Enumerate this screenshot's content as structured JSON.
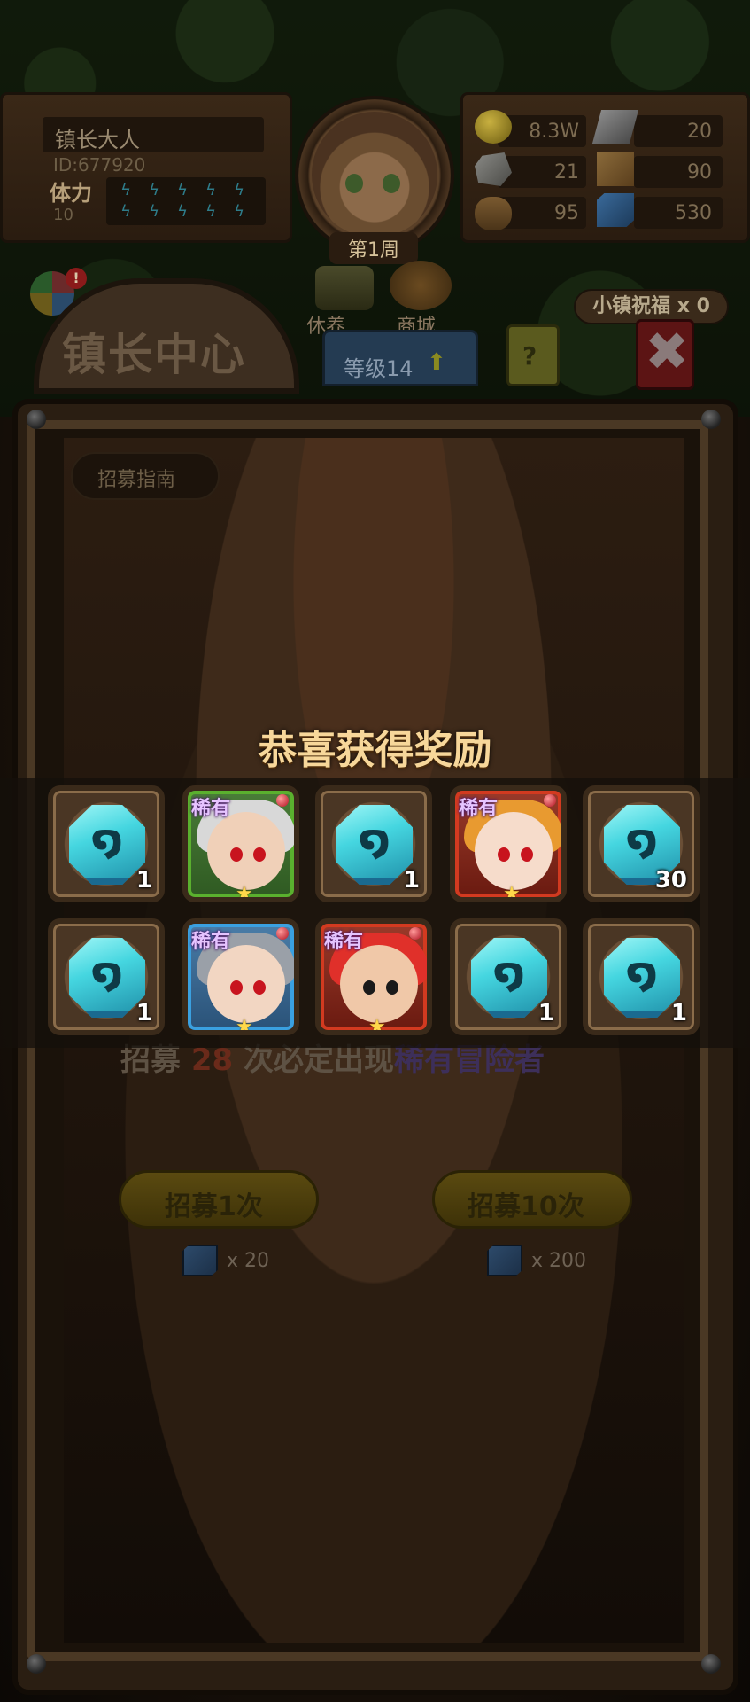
{
  "player": {
    "name": "镇长大人",
    "id": "ID:677920",
    "stamina_label": "体力",
    "stamina_value": "10",
    "week": "第1周"
  },
  "resources": [
    {
      "icon": "gold-coin-icon",
      "value": "8.3W"
    },
    {
      "icon": "iron-ingot-icon",
      "value": "20"
    },
    {
      "icon": "stone-ore-icon",
      "value": "21"
    },
    {
      "icon": "map-scroll-icon",
      "value": "90"
    },
    {
      "icon": "wood-log-icon",
      "value": "95"
    },
    {
      "icon": "blue-gem-icon",
      "value": "530"
    }
  ],
  "nav": {
    "rest": "休养",
    "shop": "商城",
    "blessing": "小镇祝福 x 0",
    "notification_badge": "!"
  },
  "tabs": {
    "center": "镇长中心",
    "level": "等级14",
    "help": "?",
    "close": "✖"
  },
  "recruit": {
    "guide": "招募指南",
    "pity_prefix": "招募",
    "pity_count": "28",
    "pity_mid": "次必定出现",
    "pity_rare": "稀有冒险者",
    "single_label": "招募1次",
    "single_cost": "x 20",
    "ten_label": "招募10次",
    "ten_cost": "x 200"
  },
  "reward": {
    "title": "恭喜获得奖励",
    "rare_tag": "稀有",
    "items": [
      {
        "kind": "item",
        "name": "rune-stone",
        "qty": "1"
      },
      {
        "kind": "hero",
        "name": "white-hair-hero",
        "frame": "green",
        "tag": "稀有"
      },
      {
        "kind": "item",
        "name": "rune-stone",
        "qty": "1"
      },
      {
        "kind": "hero",
        "name": "orange-hair-heroine",
        "frame": "red",
        "tag": "稀有"
      },
      {
        "kind": "item",
        "name": "rune-stone",
        "qty": "30"
      },
      {
        "kind": "item",
        "name": "rune-stone",
        "qty": "1"
      },
      {
        "kind": "hero",
        "name": "silver-hair-hero",
        "frame": "blue",
        "tag": "稀有"
      },
      {
        "kind": "hero",
        "name": "red-hair-hero",
        "frame": "red",
        "tag": "稀有"
      },
      {
        "kind": "item",
        "name": "rune-stone",
        "qty": "1"
      },
      {
        "kind": "item",
        "name": "rune-stone",
        "qty": "1"
      }
    ]
  },
  "colors": {
    "title_gold": "#f7d79a",
    "rune_cyan": "#45d6e0",
    "rare_purple": "#e6c4ff",
    "pity_red": "#d23a20"
  }
}
